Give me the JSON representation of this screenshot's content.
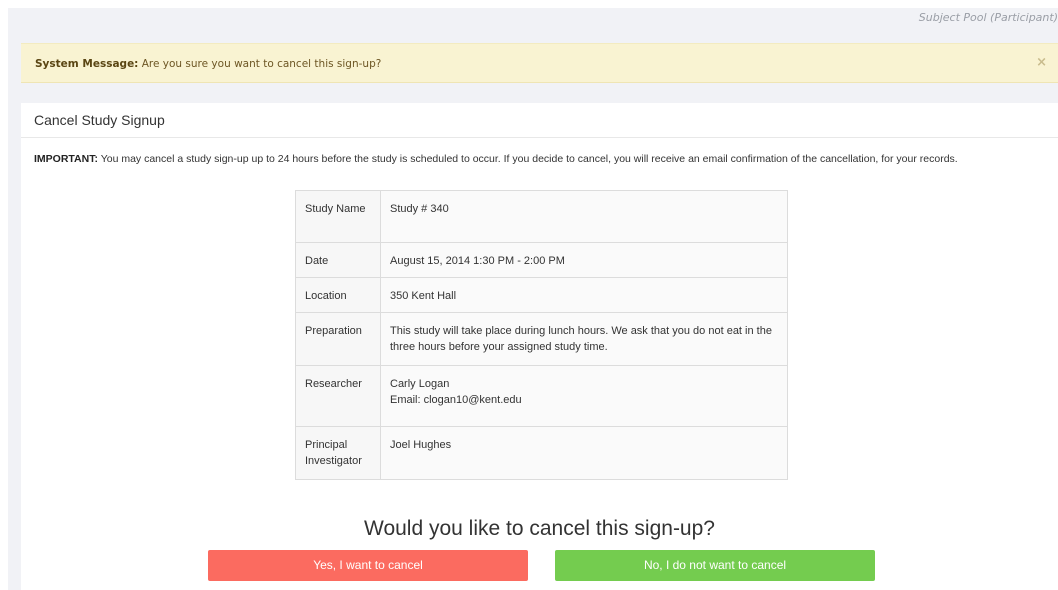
{
  "breadcrumb": "Subject Pool (Participant)",
  "alert": {
    "label": "System Message:",
    "message": " Are you sure you want to cancel this sign-up?",
    "close": "×"
  },
  "panel": {
    "title": "Cancel Study Signup",
    "notice_label": "IMPORTANT:",
    "notice_text": " You may cancel a study sign-up up to 24 hours before the study is scheduled to occur. If you decide to cancel, you will receive an email confirmation of the cancellation, for your records."
  },
  "details": [
    {
      "key": "Study Name",
      "value": "Study # 340"
    },
    {
      "key": "Date",
      "value": "August 15, 2014 1:30 PM - 2:00 PM"
    },
    {
      "key": "Location",
      "value": "350 Kent Hall"
    },
    {
      "key": "Preparation",
      "value": "This study will take place during lunch hours. We ask that you do not eat in the three hours before your assigned study time."
    },
    {
      "key": "Researcher",
      "value": "Carly Logan",
      "value2": "Email: clogan10@kent.edu"
    },
    {
      "key": "Principal Investigator",
      "value": "Joel Hughes"
    }
  ],
  "question": "Would you like to cancel this sign-up?",
  "buttons": {
    "yes": "Yes, I want to cancel",
    "no": "No, I do not want to cancel"
  },
  "colors": {
    "alert_bg": "#f9f3d2",
    "yes_button": "#fb6b60",
    "no_button": "#74cc4f"
  }
}
